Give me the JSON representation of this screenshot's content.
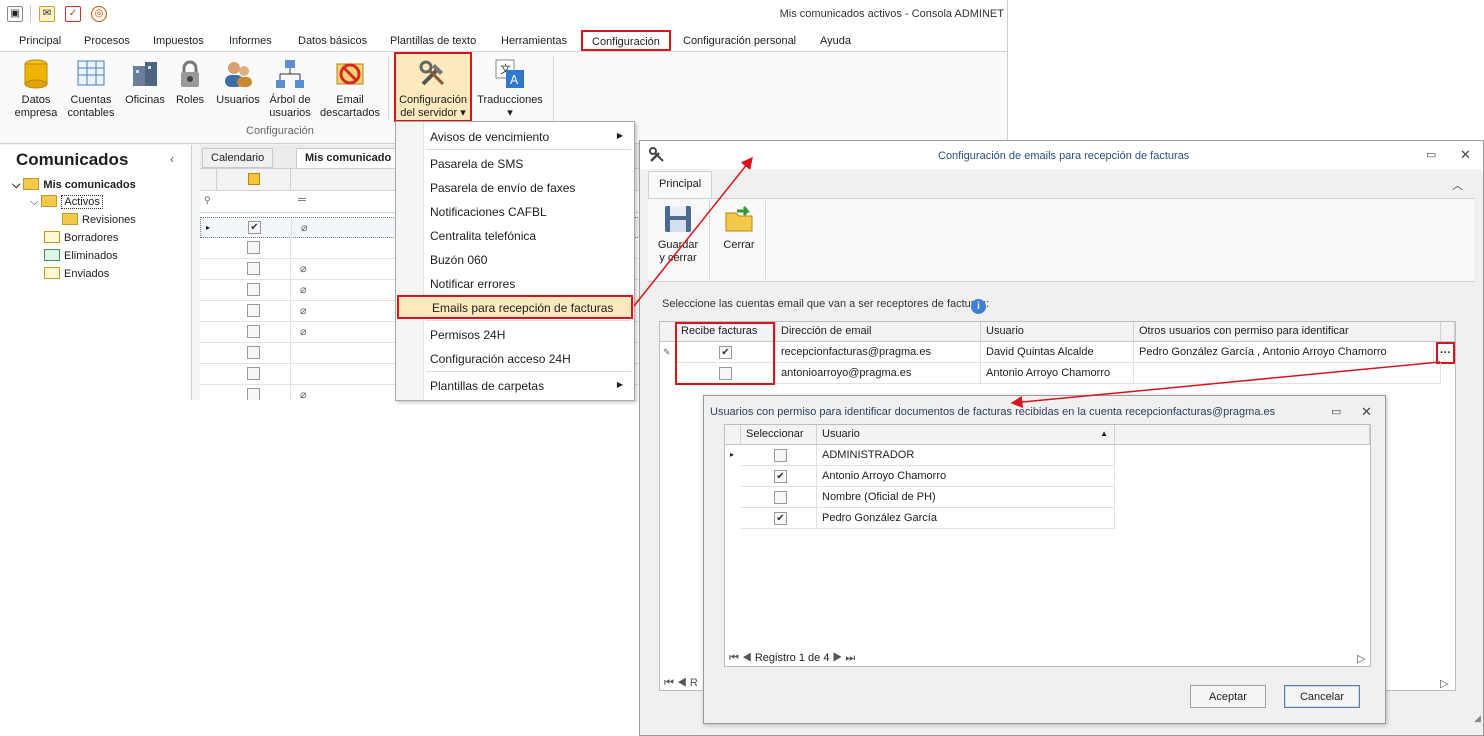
{
  "main": {
    "title": "Mis comunicados activos - Consola ADMINET",
    "menu": [
      "Principal",
      "Procesos",
      "Impuestos",
      "Informes",
      "Datos básicos",
      "Plantillas de texto",
      "Herramientas",
      "Configuración",
      "Configuración personal",
      "Ayuda"
    ],
    "ribbon": {
      "buttons": [
        {
          "line1": "Datos",
          "line2": "empresa"
        },
        {
          "line1": "Cuentas",
          "line2": "contables"
        },
        {
          "line1": "Oficinas",
          "line2": ""
        },
        {
          "line1": "Roles",
          "line2": ""
        },
        {
          "line1": "Usuarios",
          "line2": ""
        },
        {
          "line1": "Árbol de",
          "line2": "usuarios"
        },
        {
          "line1": "Email",
          "line2": "descartados"
        },
        {
          "line1": "Configuración",
          "line2": "del servidor ▾"
        },
        {
          "line1": "Traducciones",
          "line2": "▾"
        }
      ],
      "group_label": "Configuración"
    },
    "left_panel": {
      "title": "Comunicados",
      "tree": [
        "Mis comunicados",
        "Activos",
        "Revisiones",
        "Borradores",
        "Eliminados",
        "Enviados"
      ]
    },
    "tabs": [
      "Calendario",
      "Mis comunicado"
    ],
    "grid_rows": [
      {
        "checked": true,
        "clip": true
      },
      {
        "checked": false,
        "clip": false
      },
      {
        "checked": false,
        "clip": true
      },
      {
        "checked": false,
        "clip": true
      },
      {
        "checked": false,
        "clip": true
      },
      {
        "checked": false,
        "clip": true
      },
      {
        "checked": false,
        "clip": false
      },
      {
        "checked": false,
        "clip": false
      },
      {
        "checked": false,
        "clip": true
      }
    ]
  },
  "dropdown": {
    "items": [
      "Avisos de vencimiento",
      "Pasarela de SMS",
      "Pasarela de envío de faxes",
      "Notificaciones CAFBL",
      "Centralita telefónica",
      "Buzón 060",
      "Notificar errores",
      "Emails para recepción de facturas",
      "Permisos 24H",
      "Configuración acceso 24H",
      "Plantillas de carpetas"
    ]
  },
  "config_window": {
    "title": "Configuración de emails para recepción de facturas",
    "tab": "Principal",
    "buttons": [
      {
        "line1": "Guardar",
        "line2": "y cerrar"
      },
      {
        "line1": "Cerrar",
        "line2": ""
      }
    ],
    "prompt": "Seleccione las cuentas email que van a ser receptores de facturas:",
    "columns": [
      "Recibe facturas",
      "Dirección de email",
      "Usuario",
      "Otros usuarios con permiso para identificar"
    ],
    "rows": [
      {
        "receives": true,
        "email": "recepcionfacturas@pragma.es",
        "user": "David Quintas Alcalde",
        "others": "Pedro González García , Antonio Arroyo Chamorro"
      },
      {
        "receives": false,
        "email": "antonioarroyo@pragma.es",
        "user": "Antonio Arroyo Chamorro",
        "others": ""
      }
    ],
    "ellipsis": "···",
    "nav_label": "R"
  },
  "users_dialog": {
    "title": "Usuarios con permiso para identificar documentos de facturas recibidas en la cuenta recepcionfacturas@pragma.es",
    "columns": [
      "Seleccionar",
      "Usuario"
    ],
    "rows": [
      {
        "selected": false,
        "user": "ADMINISTRADOR"
      },
      {
        "selected": true,
        "user": "Antonio Arroyo Chamorro"
      },
      {
        "selected": false,
        "user": "Nombre (Oficial de PH)"
      },
      {
        "selected": true,
        "user": "Pedro González García"
      }
    ],
    "record_label": "Registro 1 de 4",
    "accept": "Aceptar",
    "cancel": "Cancelar"
  },
  "colors": {
    "highlight": "#d9141c",
    "folder": "#f2c94c",
    "menu_hover": "#fce9bd"
  }
}
